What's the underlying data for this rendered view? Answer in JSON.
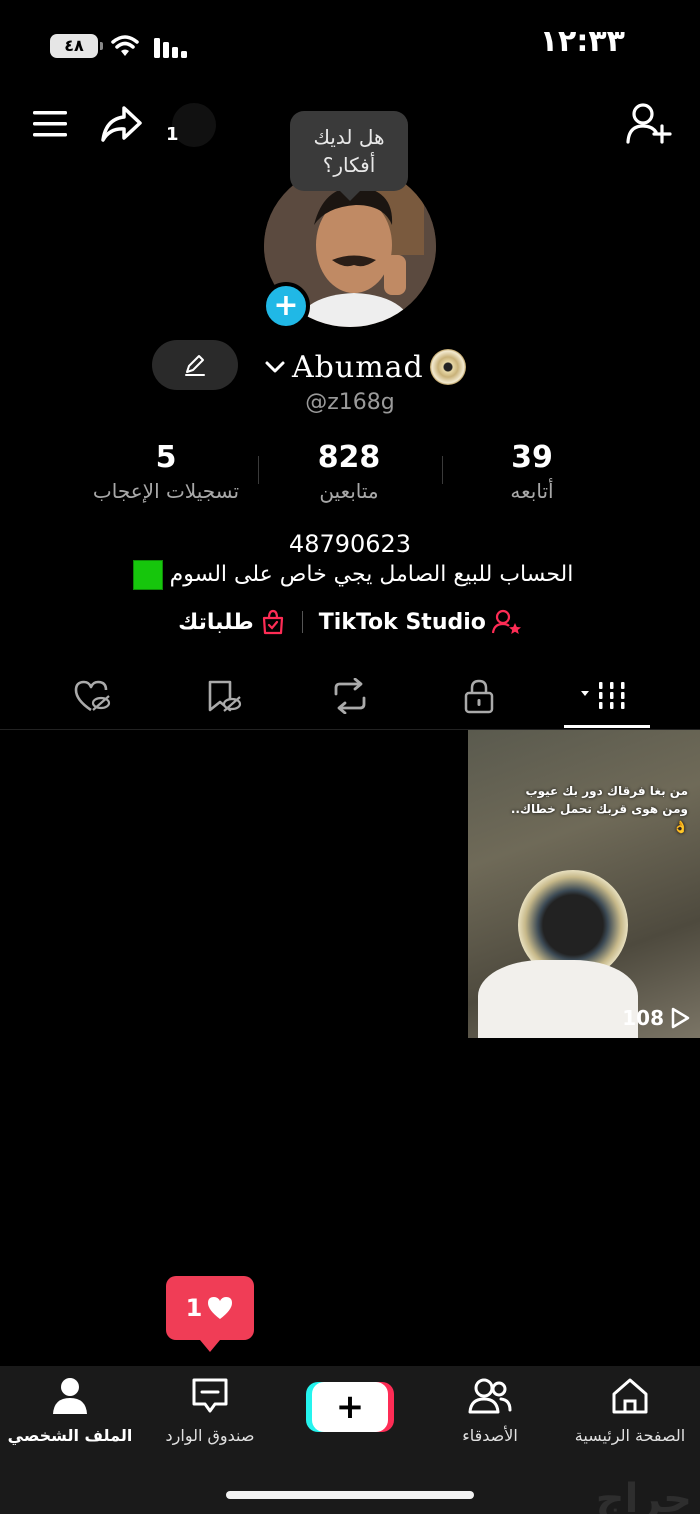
{
  "status_bar": {
    "time": "١٢:٣٣",
    "battery": "٤٨"
  },
  "header": {
    "notification_count": "1"
  },
  "profile": {
    "idea_prompt_line1": "هل لديك",
    "idea_prompt_line2": "أفكار؟",
    "display_name": "Abumad",
    "username": "@z168g",
    "stats": {
      "following_count": "39",
      "following_label": "أتابعه",
      "followers_count": "828",
      "followers_label": "متابعين",
      "likes_count": "5",
      "likes_label": "تسجيلات الإعجاب"
    },
    "bio_number": "48790623",
    "bio_text": "الحساب للبيع الصامل يجي خاص على السوم",
    "studio_link": "TikTok Studio",
    "orders_link": "طلباتك"
  },
  "videos": [
    {
      "caption_line1": "من بغا فرقاك دور بك عيوب",
      "caption_line2": "ومن هوى قربك تحمل خطاك..👌",
      "views": "108"
    }
  ],
  "like_toast": {
    "count": "1"
  },
  "bottom_nav": {
    "home": "الصفحة الرئيسية",
    "friends": "الأصدقاء",
    "create": "+",
    "inbox": "صندوق الوارد",
    "profile": "الملف الشخصي"
  },
  "watermark": "حراج",
  "colors": {
    "accent_cyan": "#20b8e6",
    "accent_red": "#f03d56",
    "tiktok_cyan": "#25f4ee",
    "tiktok_pink": "#fe2c55",
    "green_square": "#16c60c"
  }
}
